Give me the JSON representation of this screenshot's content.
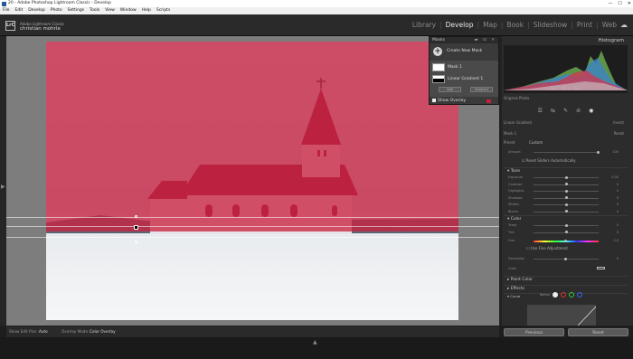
{
  "window": {
    "title": "20 - Adobe Photoshop Lightroom Classic - Develop",
    "controls": [
      "—",
      "☐",
      "✕"
    ]
  },
  "menu": [
    "File",
    "Edit",
    "Develop",
    "Photo",
    "Settings",
    "Tools",
    "View",
    "Window",
    "Help",
    "Scripts"
  ],
  "identity": {
    "logo": "LrC",
    "app_name": "Adobe Lightroom Classic",
    "user": "christian mohrle"
  },
  "modules": [
    "Library",
    "Develop",
    "Map",
    "Book",
    "Slideshow",
    "Print",
    "Web"
  ],
  "active_module": "Develop",
  "masks_panel": {
    "title": "Masks",
    "create_label": "Create New Mask",
    "mask_name": "Mask 1",
    "component_name": "Linear Gradient 1",
    "add_label": "Add",
    "subtract_label": "Subtract",
    "show_overlay_label": "Show Overlay",
    "overlay_color": "#c8203a"
  },
  "right_panel": {
    "histogram_title": "Histogram",
    "readout": [
      "54.2",
      "55.3",
      "42.3"
    ],
    "original_photo": "Original Photo",
    "tools": [
      "☰",
      "⇆",
      "✎",
      "⊘",
      "◉"
    ],
    "mask_type": "Linear Gradient",
    "invert_label": "Invert",
    "mask_label": "Mask 1",
    "reset_label": "Reset",
    "preset_label": "Preset",
    "preset_value": "Custom",
    "amount_label": "Amount",
    "amount_value": "100",
    "auto_reset": "Reset Sliders Automatically",
    "tone_header": "Tone",
    "tone_sliders": [
      {
        "label": "Exposure",
        "value": "0.00",
        "pos": 0.5
      },
      {
        "label": "Contrast",
        "value": "0",
        "pos": 0.5
      },
      {
        "label": "Highlights",
        "value": "0",
        "pos": 0.5
      },
      {
        "label": "Shadows",
        "value": "0",
        "pos": 0.5
      },
      {
        "label": "Whites",
        "value": "0",
        "pos": 0.5
      },
      {
        "label": "Blacks",
        "value": "0",
        "pos": 0.5
      }
    ],
    "color_header": "Color",
    "color_sliders": [
      {
        "label": "Temp",
        "value": "0",
        "pos": 0.5
      },
      {
        "label": "Tint",
        "value": "0",
        "pos": 0.5
      }
    ],
    "hue_label": "Hue",
    "hue_value": "0.0",
    "fine_adjust": "Use Fine Adjustment",
    "saturation_label": "Saturation",
    "saturation_value": "0",
    "color_label": "Color",
    "point_color_header": "Point Color",
    "effects_header": "Effects",
    "curve_header": "Curve",
    "refine_label": "Refine",
    "previous_label": "Previous",
    "reset_button": "Reset"
  },
  "toolbar": {
    "show_edit_pins_label": "Show Edit Pins :",
    "show_edit_pins_value": "Auto",
    "overlay_mode_label": "Overlay Mode :",
    "overlay_mode_value": "Color Overlay"
  }
}
